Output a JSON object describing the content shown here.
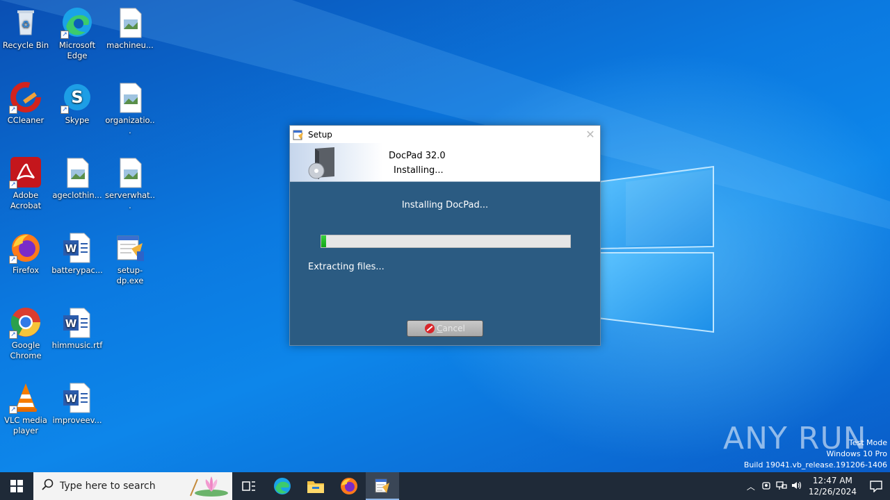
{
  "desktop_icons": [
    {
      "label": "Recycle Bin",
      "icon": "recycle-bin-icon"
    },
    {
      "label": "Microsoft Edge",
      "icon": "edge-icon"
    },
    {
      "label": "machineu...",
      "icon": "image-file-icon"
    },
    {
      "label": "CCleaner",
      "icon": "ccleaner-icon"
    },
    {
      "label": "Skype",
      "icon": "skype-icon"
    },
    {
      "label": "organizatio...",
      "icon": "image-file-icon"
    },
    {
      "label": "Adobe Acrobat",
      "icon": "acrobat-icon"
    },
    {
      "label": "ageclothin...",
      "icon": "image-file-icon"
    },
    {
      "label": "serverwhat...",
      "icon": "image-file-icon"
    },
    {
      "label": "Firefox",
      "icon": "firefox-icon"
    },
    {
      "label": "batterypac...",
      "icon": "word-doc-icon"
    },
    {
      "label": "setup-dp.exe",
      "icon": "installer-icon"
    },
    {
      "label": "Google Chrome",
      "icon": "chrome-icon"
    },
    {
      "label": "himmusic.rtf",
      "icon": "word-doc-icon"
    },
    {
      "label": "VLC media player",
      "icon": "vlc-icon"
    },
    {
      "label": "improveev...",
      "icon": "word-doc-icon"
    }
  ],
  "setup": {
    "title": "Setup",
    "header_title": "DocPad 32.0",
    "header_subtitle": "Installing...",
    "message": "Installing DocPad...",
    "status": "Extracting files...",
    "progress_percent": 2,
    "cancel_label_first": "C",
    "cancel_label_rest": "ancel",
    "colors": {
      "body": "#2b5b82",
      "progress_fill": "#1fb524"
    }
  },
  "watermark": {
    "brand": "ANY RUN",
    "line1": "Test Mode",
    "line2": "Windows 10 Pro",
    "line3": "Build 19041.vb_release.191206-1406"
  },
  "taskbar": {
    "search_placeholder": "Type here to search",
    "pinned": [
      "task-view-icon",
      "edge-icon",
      "file-explorer-icon",
      "firefox-icon",
      "setup-app-icon"
    ],
    "time": "12:47 AM",
    "date": "12/26/2024"
  }
}
